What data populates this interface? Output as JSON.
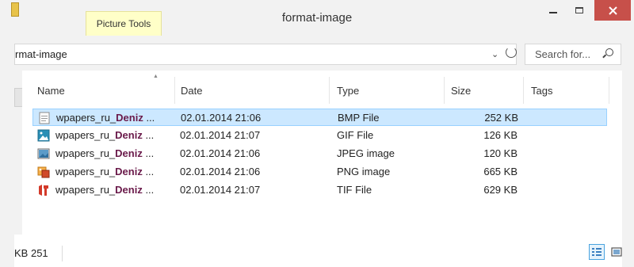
{
  "window": {
    "title": "format-image",
    "context_tab": "Picture Tools"
  },
  "address": {
    "path": "rmat-image",
    "search_placeholder": "Search for..."
  },
  "columns": {
    "name": "Name",
    "date": "Date",
    "type": "Type",
    "size": "Size",
    "tags": "Tags"
  },
  "files": [
    {
      "prefix": "wpapers_ru_",
      "bold": "Deniz",
      "suffix": " ...",
      "date": "02.01.2014 21:06",
      "type": "BMP File",
      "size": "252 KB",
      "icon": "bmp-file-icon",
      "selected": true
    },
    {
      "prefix": "wpapers_ru_",
      "bold": "Deniz",
      "suffix": " ...",
      "date": "02.01.2014 21:07",
      "type": "GIF File",
      "size": "126 KB",
      "icon": "gif-file-icon",
      "selected": false
    },
    {
      "prefix": "wpapers_ru_",
      "bold": "Deniz",
      "suffix": " ...",
      "date": "02.01.2014 21:06",
      "type": "JPEG image",
      "size": "120 KB",
      "icon": "jpeg-file-icon",
      "selected": false
    },
    {
      "prefix": "wpapers_ru_",
      "bold": "Deniz",
      "suffix": " ...",
      "date": "02.01.2014 21:06",
      "type": "PNG image",
      "size": "665 KB",
      "icon": "png-file-icon",
      "selected": false
    },
    {
      "prefix": "wpapers_ru_",
      "bold": "Deniz",
      "suffix": " ...",
      "date": "02.01.2014 21:07",
      "type": "TIF File",
      "size": "629 KB",
      "icon": "tif-file-icon",
      "selected": false
    }
  ],
  "status": {
    "selection_size": "251 KB"
  },
  "colors": {
    "selection_bg": "#cce8ff",
    "selection_border": "#99d1ff",
    "close_button": "#c7504a",
    "context_tab": "#ffffc8"
  }
}
